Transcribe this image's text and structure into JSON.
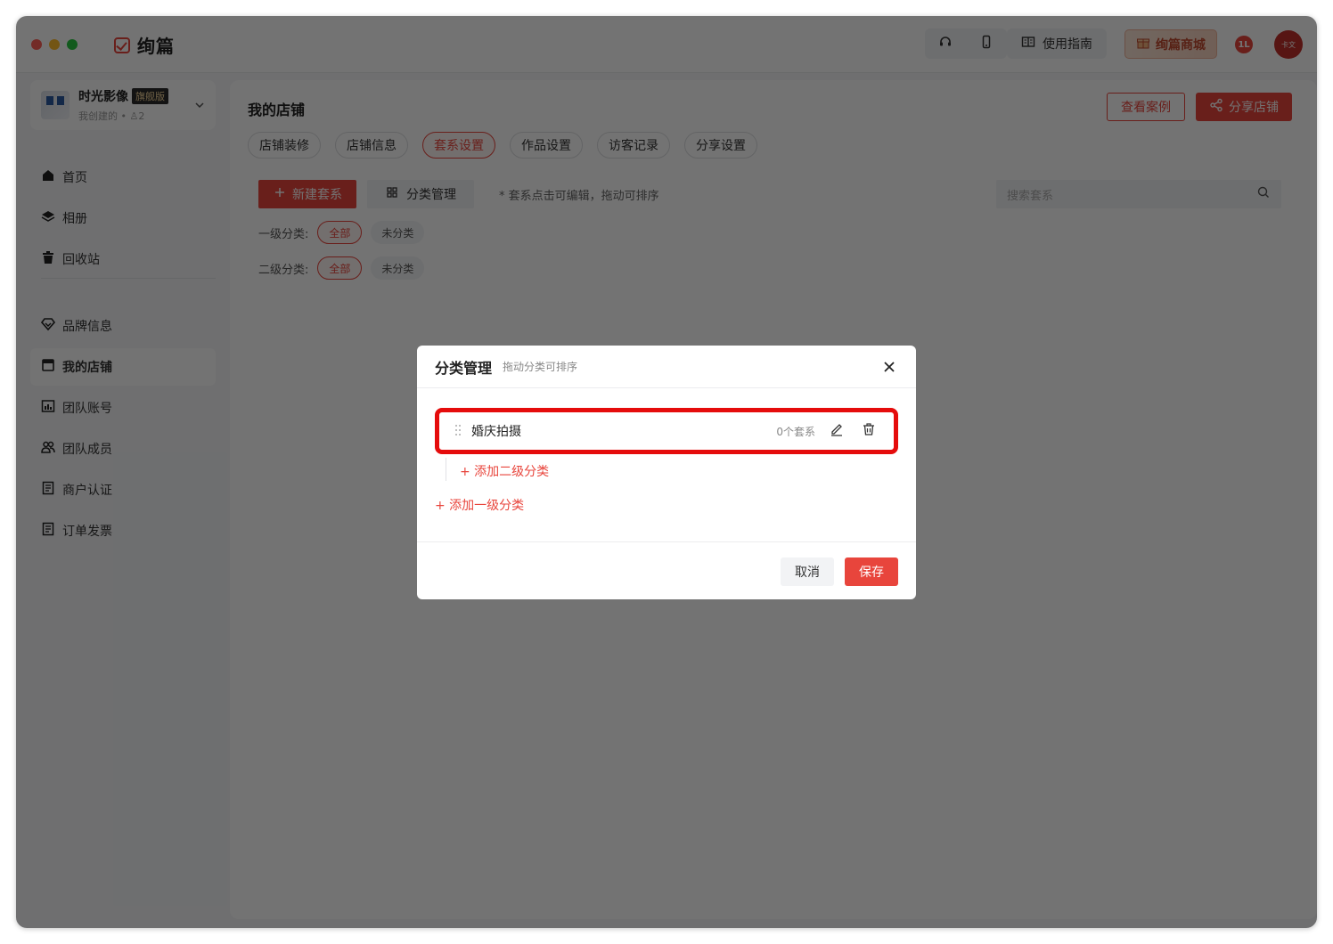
{
  "app": {
    "name": "绚篇"
  },
  "titlebar": {
    "guide_label": "使用指南",
    "mall_label": "绚篇商城",
    "badge_text": "1L",
    "avatar_text": "卡文"
  },
  "studio": {
    "name": "时光影像",
    "tag": "旗舰版",
    "sub": "我创建的 • ♙2"
  },
  "sidebar": {
    "items": [
      {
        "label": "首页",
        "icon": "home-icon"
      },
      {
        "label": "相册",
        "icon": "layers-icon"
      },
      {
        "label": "回收站",
        "icon": "trash-icon"
      },
      {
        "label": "品牌信息",
        "icon": "diamond-icon"
      },
      {
        "label": "我的店铺",
        "icon": "store-icon"
      },
      {
        "label": "团队账号",
        "icon": "chart-icon"
      },
      {
        "label": "团队成员",
        "icon": "users-icon"
      },
      {
        "label": "商户认证",
        "icon": "document-icon"
      },
      {
        "label": "订单发票",
        "icon": "invoice-icon"
      }
    ],
    "active_index": 4
  },
  "main": {
    "title": "我的店铺",
    "view_cases": "查看案例",
    "share_store": "分享店铺",
    "tabs": [
      {
        "label": "店铺装修"
      },
      {
        "label": "店铺信息"
      },
      {
        "label": "套系设置"
      },
      {
        "label": "作品设置"
      },
      {
        "label": "访客记录"
      },
      {
        "label": "分享设置"
      }
    ],
    "active_tab": 2,
    "new_label": "新建套系",
    "category_mgmt": "分类管理",
    "hint": "* 套系点击可编辑，拖动可排序",
    "search_placeholder": "搜索套系",
    "filter1": {
      "label": "一级分类:",
      "chips": [
        "全部",
        "未分类"
      ]
    },
    "filter2": {
      "label": "二级分类:",
      "chips": [
        "全部",
        "未分类"
      ]
    }
  },
  "modal": {
    "title": "分类管理",
    "subtitle": "拖动分类可排序",
    "category": {
      "name": "婚庆拍摄",
      "count": "0个套系"
    },
    "add_sub": "+ 添加二级分类",
    "add_top": "+ 添加一级分类",
    "cancel": "取消",
    "save": "保存"
  },
  "colors": {
    "accent": "#e8453c",
    "highlight": "#e50c0c"
  }
}
